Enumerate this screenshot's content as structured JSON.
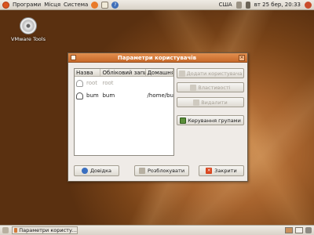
{
  "top_panel": {
    "menus": [
      "Програми",
      "Місця",
      "Система"
    ],
    "keyboard_layout": "США",
    "clock": "вт 25 бер, 20:33"
  },
  "desktop": {
    "icons": [
      {
        "label": "VMware Tools",
        "icon": "cdrom-icon"
      }
    ]
  },
  "dialog": {
    "title": "Параметри користувачів",
    "columns": [
      "Назва",
      "Обліковий запис",
      "Домашня тека"
    ],
    "rows": [
      {
        "name": "root",
        "account": "root",
        "home": "",
        "disabled": true
      },
      {
        "name": "bum",
        "account": "bum",
        "home": "/home/bu",
        "disabled": false
      }
    ],
    "side_buttons": {
      "add_user": "Додати користувача",
      "properties": "Властивості",
      "delete": "Видалити",
      "manage_groups": "Керування групами"
    },
    "bottom_buttons": {
      "help": "Довідка",
      "unlock": "Розблокувати",
      "close": "Закрити"
    }
  },
  "taskbar": {
    "task_label": "Параметри користу..."
  },
  "colors": {
    "titlebar": "#d27838",
    "panel": "#e4dfd6"
  }
}
